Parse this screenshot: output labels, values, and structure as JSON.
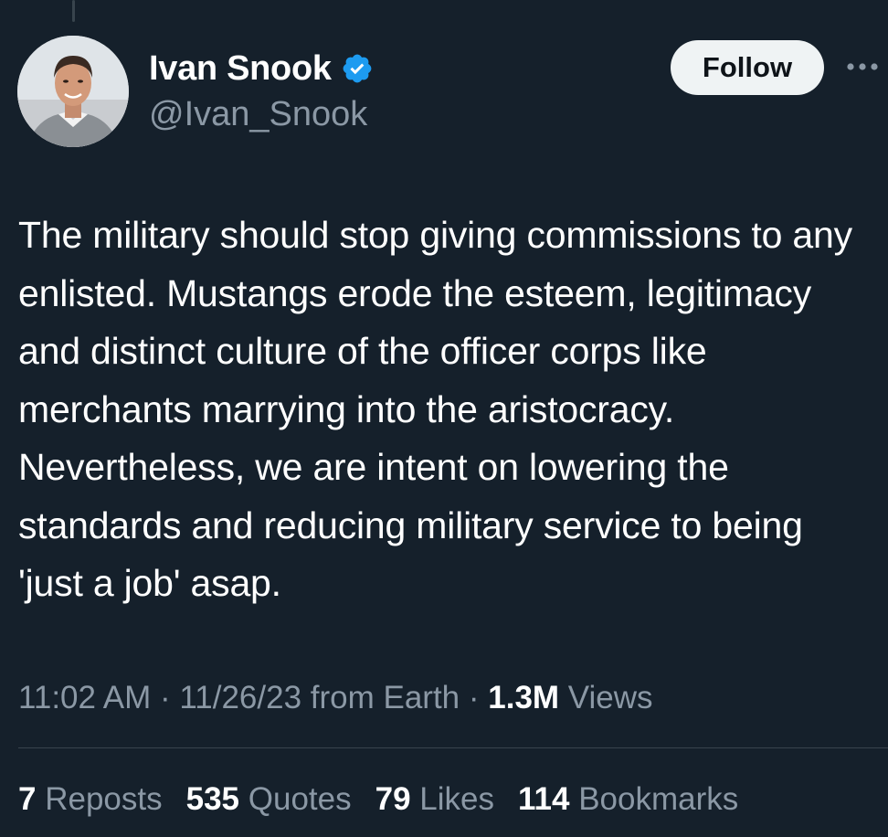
{
  "author": {
    "display_name": "Ivan Snook",
    "handle": "@Ivan_Snook",
    "verified": true,
    "verified_icon": "verified-badge-icon",
    "avatar_icon": "profile-photo"
  },
  "actions": {
    "follow_label": "Follow",
    "more_icon": "more-options-icon"
  },
  "tweet": {
    "text": "The military should stop giving commissions to any enlisted. Mustangs erode the esteem, legitimacy and distinct culture of the officer corps like merchants marrying into the aristocracy. Nevertheless, we are intent on lowering the standards and reducing military service to being 'just a job' asap."
  },
  "meta": {
    "time": "11:02 AM",
    "sep1": " · ",
    "date": "11/26/23",
    "source": " from Earth",
    "sep2": " · ",
    "views_count": "1.3M",
    "views_label": " Views"
  },
  "stats": [
    {
      "count": "7",
      "label": "Reposts"
    },
    {
      "count": "535",
      "label": "Quotes"
    },
    {
      "count": "79",
      "label": "Likes"
    },
    {
      "count": "114",
      "label": "Bookmarks"
    }
  ],
  "colors": {
    "background": "#15202b",
    "text_primary": "#ffffff",
    "text_secondary": "#8b98a5",
    "verified_blue": "#1d9bf0",
    "button_bg": "#eff3f4",
    "divider": "#38444d"
  }
}
